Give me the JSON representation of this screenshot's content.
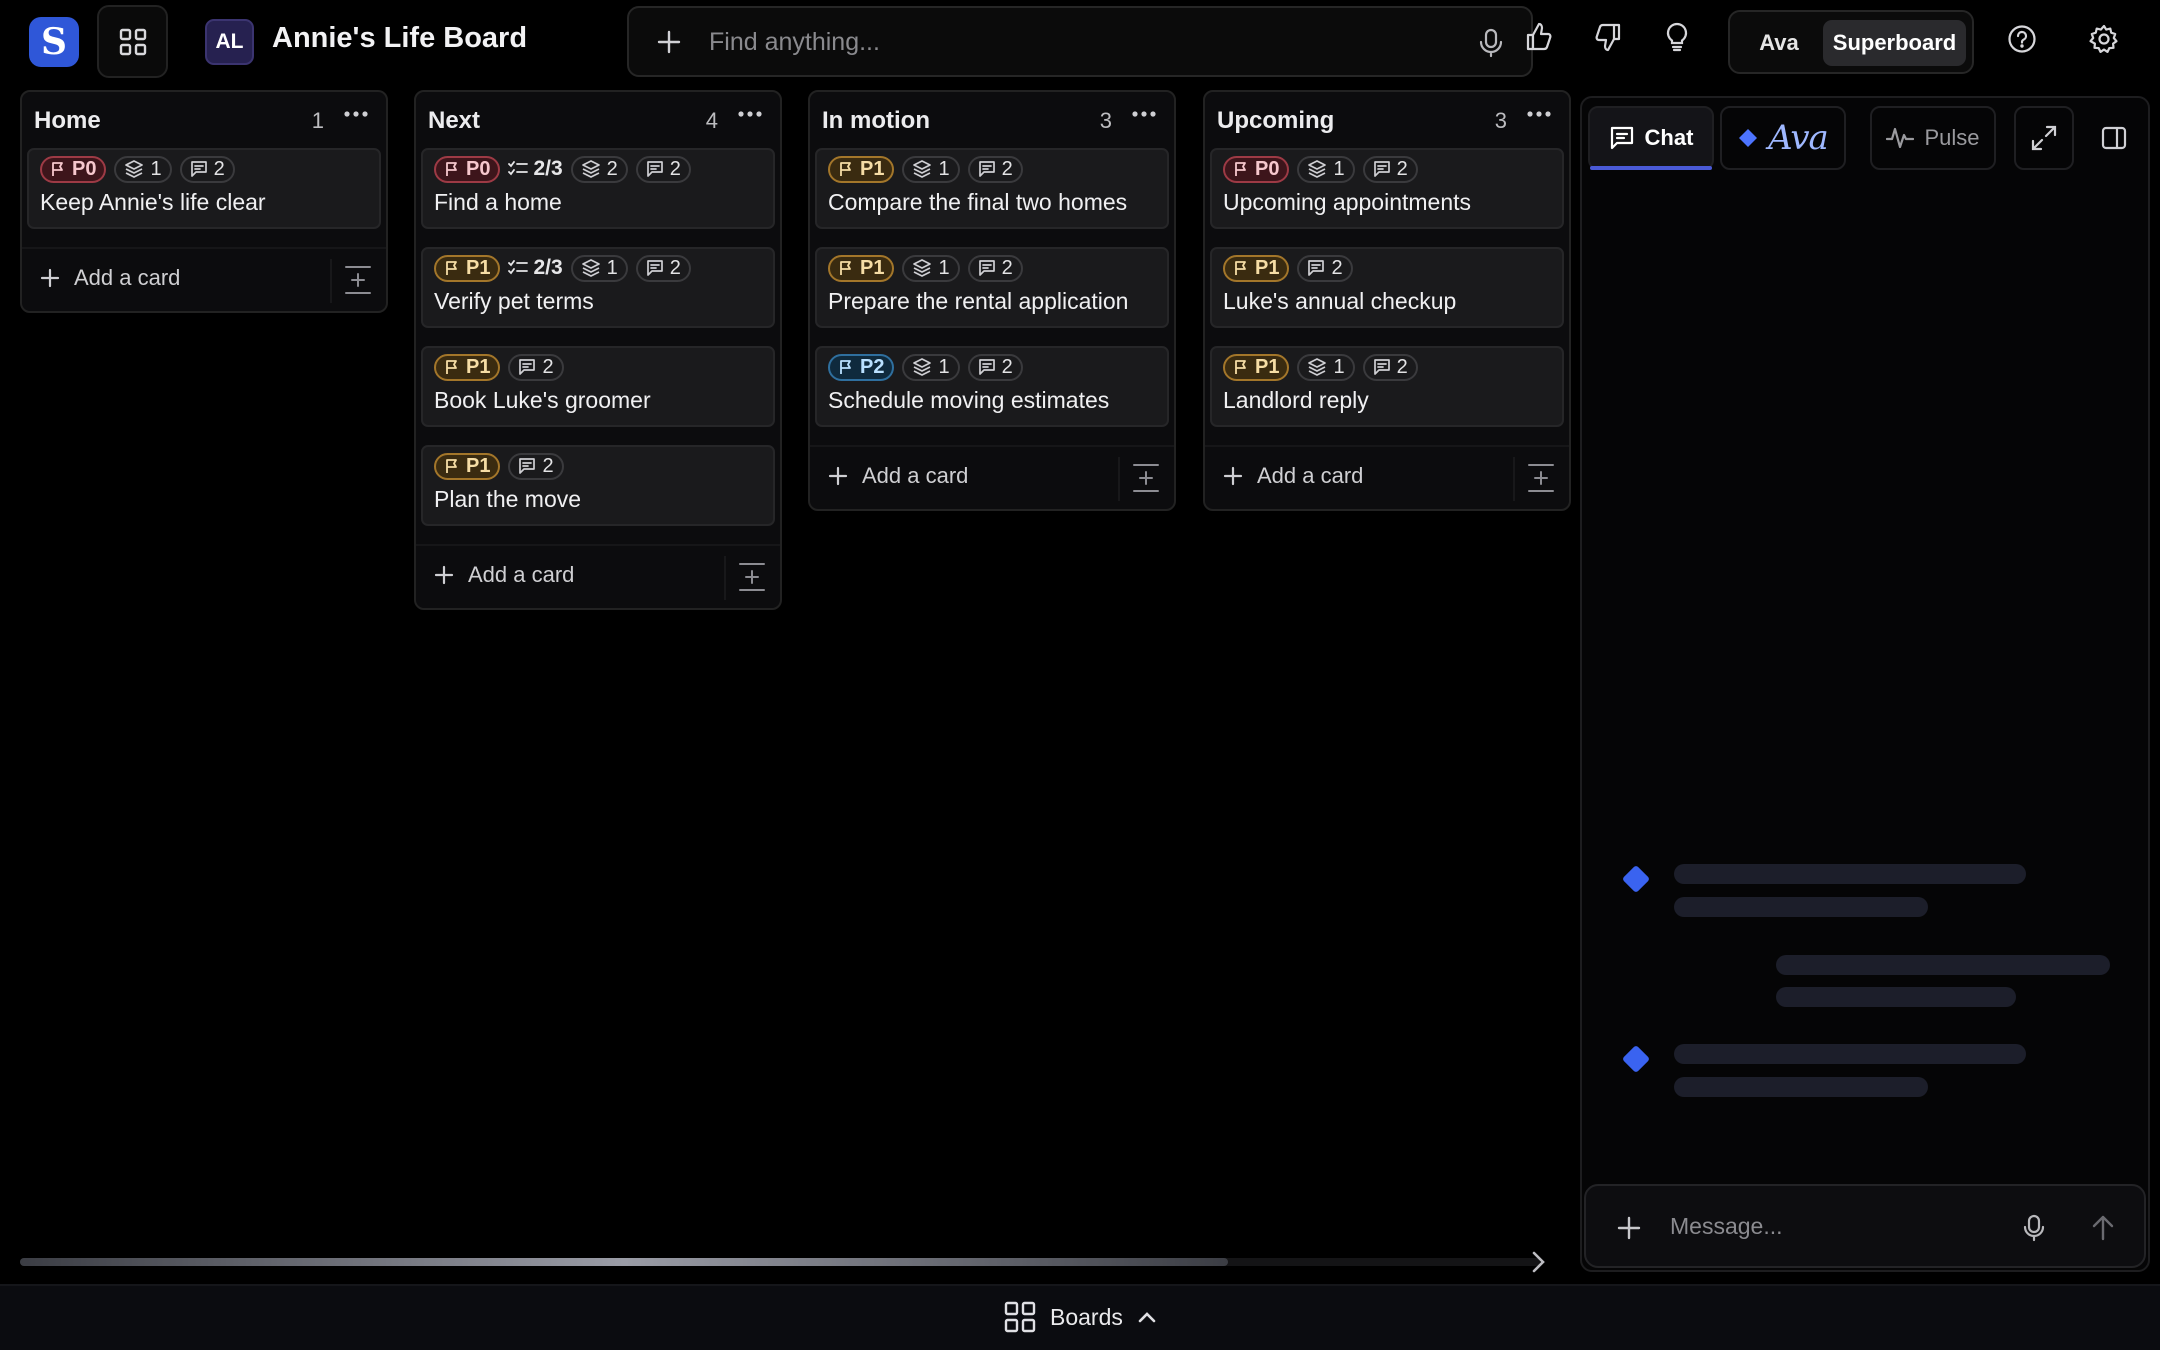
{
  "app": {
    "logo_letter": "S",
    "avatar_initials": "AL",
    "board_title": "Annie's Life Board"
  },
  "search": {
    "placeholder": "Find anything..."
  },
  "mode_toggle": {
    "option_a": "Ava",
    "option_b": "Superboard",
    "selected": "Superboard"
  },
  "columns": [
    {
      "name": "Home",
      "count": "1",
      "cards": [
        {
          "priority": "P0",
          "checklist": "",
          "subitems": "1",
          "comments": "2",
          "title": "Keep Annie's life clear"
        }
      ],
      "add_label": "Add a card"
    },
    {
      "name": "Next",
      "count": "4",
      "cards": [
        {
          "priority": "P0",
          "checklist": "2/3",
          "subitems": "2",
          "comments": "2",
          "title": "Find a home"
        },
        {
          "priority": "P1",
          "checklist": "2/3",
          "subitems": "1",
          "comments": "2",
          "title": "Verify pet terms"
        },
        {
          "priority": "P1",
          "checklist": "",
          "subitems": "",
          "comments": "2",
          "title": "Book Luke's groomer"
        },
        {
          "priority": "P1",
          "checklist": "",
          "subitems": "",
          "comments": "2",
          "title": "Plan the move"
        }
      ],
      "add_label": "Add a card"
    },
    {
      "name": "In motion",
      "count": "3",
      "cards": [
        {
          "priority": "P1",
          "checklist": "",
          "subitems": "1",
          "comments": "2",
          "title": "Compare the final two homes"
        },
        {
          "priority": "P1",
          "checklist": "",
          "subitems": "1",
          "comments": "2",
          "title": "Prepare the rental application"
        },
        {
          "priority": "P2",
          "checklist": "",
          "subitems": "1",
          "comments": "2",
          "title": "Schedule moving estimates"
        }
      ],
      "add_label": "Add a card"
    },
    {
      "name": "Upcoming",
      "count": "3",
      "cards": [
        {
          "priority": "P0",
          "checklist": "",
          "subitems": "1",
          "comments": "2",
          "title": "Upcoming appointments"
        },
        {
          "priority": "P1",
          "checklist": "",
          "subitems": "",
          "comments": "2",
          "title": "Luke's annual checkup"
        },
        {
          "priority": "P1",
          "checklist": "",
          "subitems": "1",
          "comments": "2",
          "title": "Landlord reply"
        }
      ],
      "add_label": "Add a card"
    }
  ],
  "panel": {
    "tabs": {
      "chat": "Chat",
      "ava": "Ava",
      "pulse": "Pulse",
      "active": "Chat"
    },
    "composer_placeholder": "Message..."
  },
  "bottom": {
    "boards_label": "Boards"
  },
  "colors": {
    "accent": "#4a5ad6",
    "p0": "#9d3a45",
    "p1": "#a3762a",
    "p2": "#2f6f9e",
    "logo": "#2f57d8"
  },
  "icons": [
    "apps-grid-icon",
    "plus-icon",
    "mic-icon",
    "thumbs-up-icon",
    "thumbs-down-icon",
    "lightbulb-icon",
    "help-icon",
    "gear-icon",
    "more-icon",
    "flag-icon",
    "checklist-icon",
    "layers-icon",
    "comment-icon",
    "expand-icon",
    "sidebar-icon",
    "pulse-icon",
    "send-icon",
    "chevron-up-icon",
    "chevron-right-icon"
  ]
}
